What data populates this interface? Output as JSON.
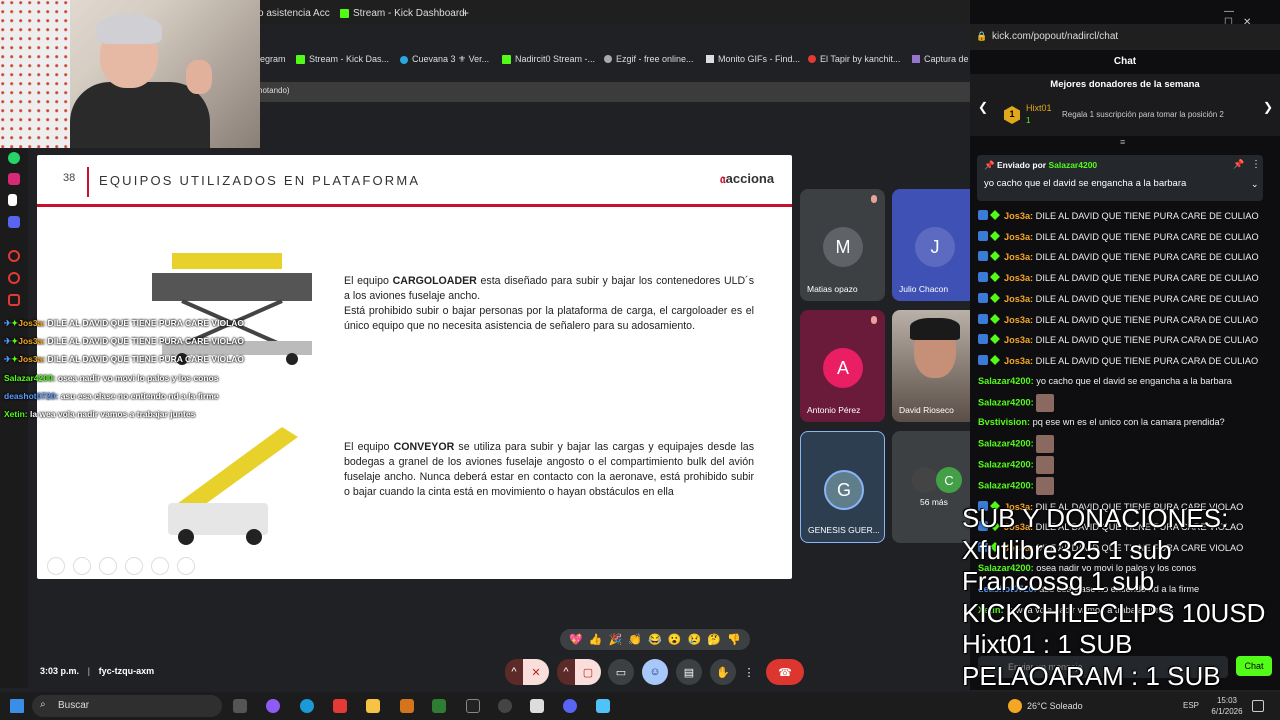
{
  "browser_left": {
    "tabs": [
      "o asistencia Acc",
      "Stream - Kick Dashboard"
    ],
    "new_tab": "+",
    "bookmarks": [
      "egram",
      "Stream - Kick Das...",
      "Cuevana 3 ⚜ Ver...",
      "Nadircit0 Stream -...",
      "Ezgif - free online...",
      "Monito GIFs - Find...",
      "El Tapir by kanchit...",
      "Captura de"
    ],
    "meet_strip": "notando)"
  },
  "slide": {
    "number": "38",
    "title": "EQUIPOS UTILIZADOS EN PLATAFORMA",
    "logo_text": "acciona",
    "para1_bold": "CARGOLOADER",
    "para1_pre": "El equipo ",
    "para1_rest": " esta diseñado para subir y bajar los contenedores ULD´s a los aviones fuselaje ancho.",
    "para1_line2": "Está prohibido subir o bajar personas por la plataforma de carga, el cargoloader es el único equipo que no necesita asistencia de señalero para su adosamiento.",
    "para2_pre": "El equipo ",
    "para2_bold": "CONVEYOR",
    "para2_rest": "  se utiliza para subir y bajar las cargas y equipajes desde las bodegas a granel de los aviones fuselaje angosto o el compartimiento bulk del avión fuselaje ancho. Nunca deberá estar en contacto con la aeronave, está prohibido subir o bajar cuando la cinta está en movimiento o hayan obstáculos en ella"
  },
  "overlay_chat": [
    {
      "user": "Jos3a:",
      "text": " DILE AL DAVID QUE TIENE PURA CARE VIOLAO",
      "color": "#f5a623"
    },
    {
      "user": "Jos3a:",
      "text": " DILE AL DAVID QUE TIENE PURA CARE VIOLAO",
      "color": "#f5a623"
    },
    {
      "user": "Jos3a:",
      "text": " DILE AL DAVID QUE TIENE PURA CARE VIOLAO",
      "color": "#f5a623"
    },
    {
      "user": "Salazar4200:",
      "text": " osea nadir vo movi lo palos y los conos",
      "color": "#53fc18"
    },
    {
      "user": "deashot0720:",
      "text": " asu esa clase no entiendo nd a la firme",
      "color": "#5b9bff"
    },
    {
      "user": "Xetin:",
      "text": " la wea vola nadir vamos a trabajar juntes",
      "color": "#53fc18"
    }
  ],
  "participants": [
    {
      "initial": "M",
      "name": "Matias opazo",
      "color": "#5f6368"
    },
    {
      "initial": "J",
      "name": "Julio Chacon",
      "color": "#3f51b5"
    },
    {
      "initial": "A",
      "name": "Antonio Pérez",
      "color": "#e91e63"
    },
    {
      "initial": "",
      "name": "David Rioseco",
      "color": "#555"
    },
    {
      "initial": "G",
      "name": "GENESIS GUER...",
      "color": "#607d8b"
    },
    {
      "initial": "C",
      "name": "56 más",
      "color": "#43a047"
    }
  ],
  "meet_info": {
    "time": "3:03 p.m.",
    "sep": "|",
    "code": "fyc-tzqu-axm"
  },
  "reactions": [
    "💖",
    "👍",
    "🎉",
    "👏",
    "😂",
    "😮",
    "😢",
    "🤔",
    "👎"
  ],
  "chat": {
    "address": "kick.com/popout/nadircl/chat",
    "header": "Chat",
    "donors_title": "Mejores donadores de la semana",
    "donor_name": "Hixt01",
    "donor_rank": "1",
    "donor_count": "1",
    "donor_cta": "Regala 1 suscripción para tomar la posición 2",
    "pinned_by_label": "Enviado por",
    "pinned_by": "Salazar4200",
    "pinned_text": "yo cacho que el david se engancha a la barbara",
    "messages": [
      {
        "user": "Jos3a:",
        "text": " DILE AL DAVID QUE TIENE PURA CARE DE CULIAO",
        "color": "#f5a623",
        "badges": true
      },
      {
        "user": "Jos3a:",
        "text": " DILE AL DAVID QUE TIENE PURA CARE DE CULIAO",
        "color": "#f5a623",
        "badges": true
      },
      {
        "user": "Jos3a:",
        "text": " DILE AL DAVID QUE TIENE PURA CARE DE CULIAO",
        "color": "#f5a623",
        "badges": true
      },
      {
        "user": "Jos3a:",
        "text": " DILE AL DAVID QUE TIENE PURA CARE DE CULIAO",
        "color": "#f5a623",
        "badges": true
      },
      {
        "user": "Jos3a:",
        "text": " DILE AL DAVID QUE TIENE PURA CARE DE CULIAO",
        "color": "#f5a623",
        "badges": true
      },
      {
        "user": "Jos3a:",
        "text": " DILE AL DAVID QUE TIENE PURA CARA DE CULIAO",
        "color": "#f5a623",
        "badges": true
      },
      {
        "user": "Jos3a:",
        "text": " DILE AL DAVID QUE TIENE PURA CARA DE CULIAO",
        "color": "#f5a623",
        "badges": true
      },
      {
        "user": "Jos3a:",
        "text": " DILE AL DAVID QUE TIENE PURA CARA DE CULIAO",
        "color": "#f5a623",
        "badges": true
      },
      {
        "user": "Salazar4200:",
        "text": " yo cacho que el david se engancha a la barbara",
        "color": "#53fc18",
        "badges": false
      },
      {
        "user": "Salazar4200:",
        "text": "",
        "color": "#53fc18",
        "badges": false,
        "emote": true
      },
      {
        "user": "Bvstivision:",
        "text": " pq ese wn es el unico con la camara prendida?",
        "color": "#53fc18",
        "badges": false
      },
      {
        "user": "Salazar4200:",
        "text": "",
        "color": "#53fc18",
        "badges": false,
        "emote": true
      },
      {
        "user": "Salazar4200:",
        "text": "",
        "color": "#53fc18",
        "badges": false,
        "emote": true
      },
      {
        "user": "Salazar4200:",
        "text": "",
        "color": "#53fc18",
        "badges": false,
        "emote": true
      },
      {
        "user": "Jos3a:",
        "text": " DILE AL DAVID QUE TIENE PURA CARE VIOLAO",
        "color": "#f5a623",
        "badges": true
      },
      {
        "user": "Jos3a:",
        "text": " DILE AL DAVID QUE TIENE PURA CARE VIOLAO",
        "color": "#f5a623",
        "badges": true
      },
      {
        "user": "Jos3a:",
        "text": " DILE AL DAVID QUE TIENE PURA CARE VIOLAO",
        "color": "#f5a623",
        "badges": true
      },
      {
        "user": "Salazar4200:",
        "text": " osea nadir vo movi lo palos y los conos",
        "color": "#53fc18",
        "badges": false
      },
      {
        "user": "deashot0720:",
        "text": " asu esa clase no entiendo nd a la firme",
        "color": "#5b9bff",
        "badges": false
      },
      {
        "user": "Xetin:",
        "text": " la wea vola nadir vamos a trabajar juntes",
        "color": "#53fc18",
        "badges": false
      }
    ],
    "input_placeholder": "Enviar un mensaje",
    "chat_button": "Chat"
  },
  "big_overlay": [
    "SUB Y DONACIONES:",
    "Xfutlibre325 1 sub",
    "Francossg 1 sub",
    "KICKCHILECLIPS 10USD",
    "Hixt01 : 1 SUB",
    "PELAOARAM : 1 SUB"
  ],
  "taskbar": {
    "search_placeholder": "Buscar",
    "weather": "26°C  Soleado",
    "lang": "ESP",
    "time": "15:03",
    "date": "6/1/2026"
  }
}
